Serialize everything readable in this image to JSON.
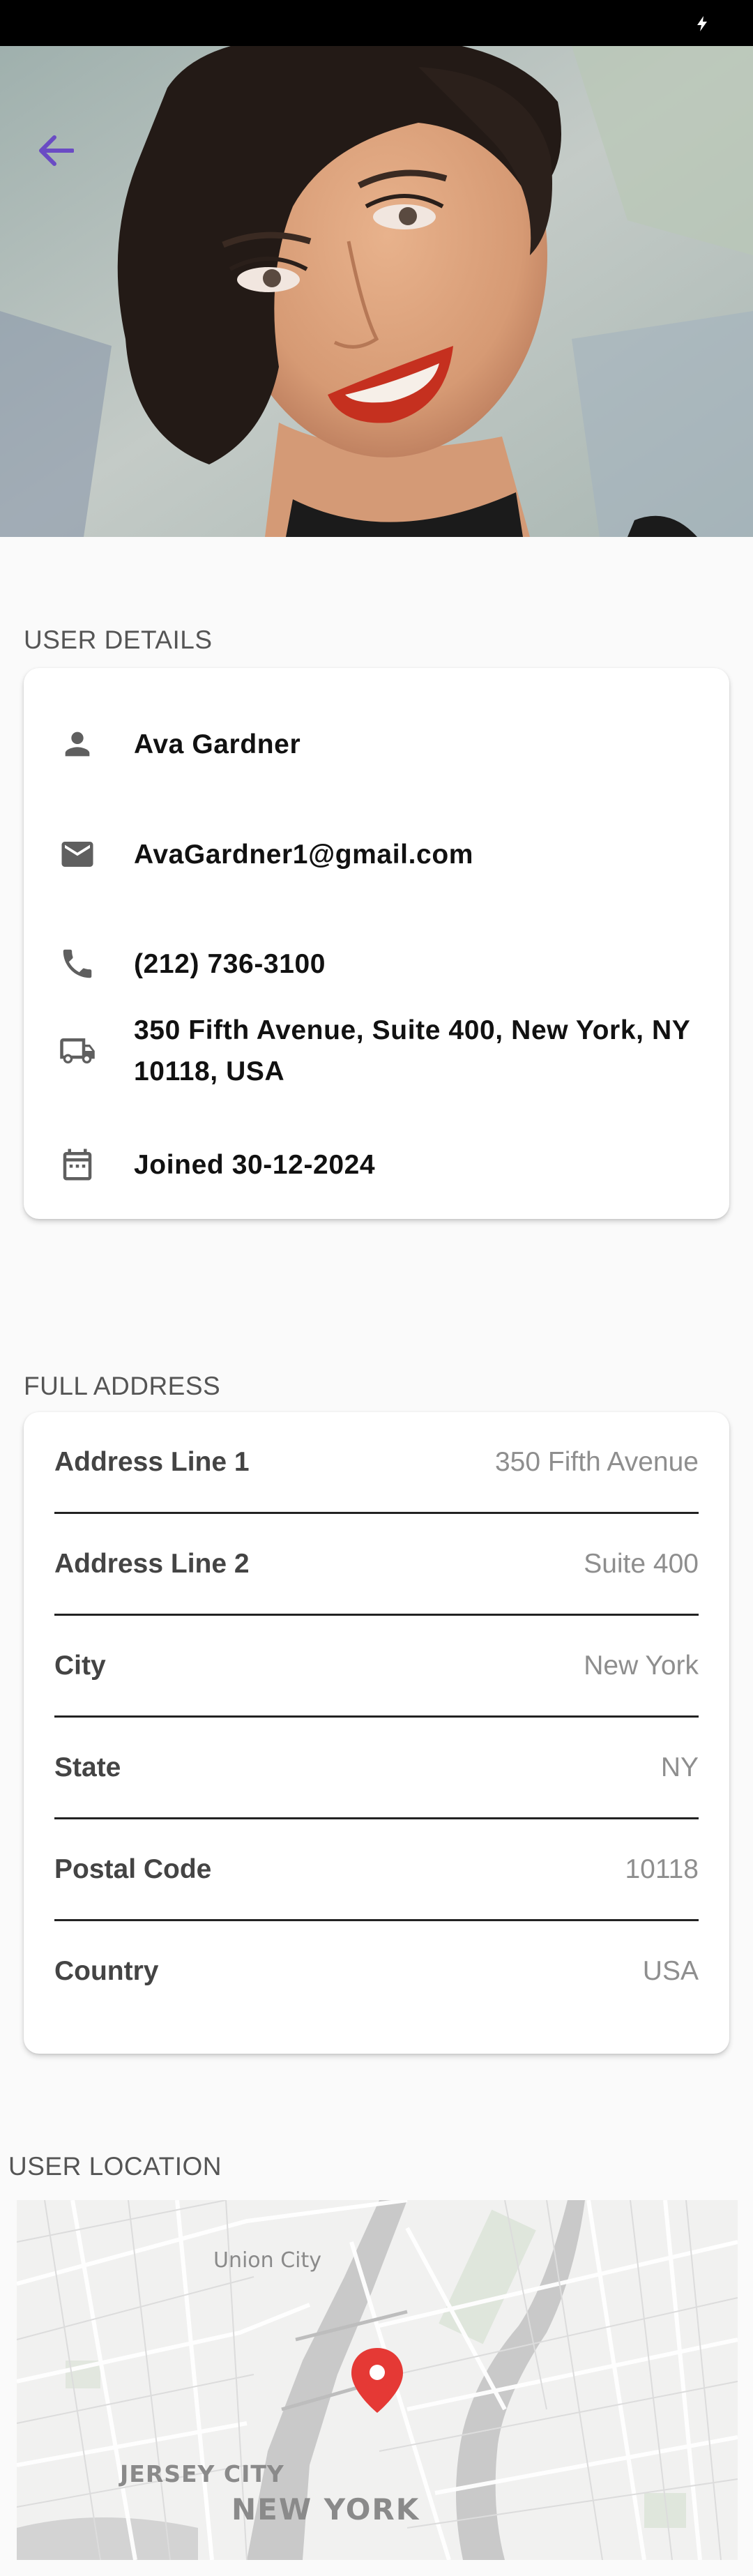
{
  "sections": {
    "user_details_label": "USER DETAILS",
    "full_address_label": "FULL ADDRESS",
    "user_location_label": "USER LOCATION"
  },
  "user": {
    "name": "Ava Gardner",
    "email": "AvaGardner1@gmail.com",
    "phone": "(212) 736-3100",
    "address": "350 Fifth Avenue, Suite 400, New York, NY 10118, USA",
    "joined": "Joined 30-12-2024"
  },
  "address_fields": [
    {
      "label": "Address Line 1",
      "value": "350 Fifth Avenue"
    },
    {
      "label": "Address Line 2",
      "value": "Suite 400"
    },
    {
      "label": "City",
      "value": "New York"
    },
    {
      "label": "State",
      "value": "NY"
    },
    {
      "label": "Postal Code",
      "value": "10118"
    },
    {
      "label": "Country",
      "value": "USA"
    }
  ],
  "map": {
    "labels": {
      "union_city": "Union City",
      "jersey_city": "JERSEY CITY",
      "new_york": "NEW YORK"
    },
    "marker_color": "#e53935"
  },
  "icons": {
    "back": "arrow-left-icon",
    "name": "person-icon",
    "email": "mail-icon",
    "phone": "phone-icon",
    "address": "truck-icon",
    "joined": "calendar-icon",
    "charging": "bolt-icon"
  },
  "colors": {
    "accent": "#6a4bc4",
    "icon": "#5f5f5f",
    "text": "#111111",
    "muted_value": "#8e8e8e"
  }
}
